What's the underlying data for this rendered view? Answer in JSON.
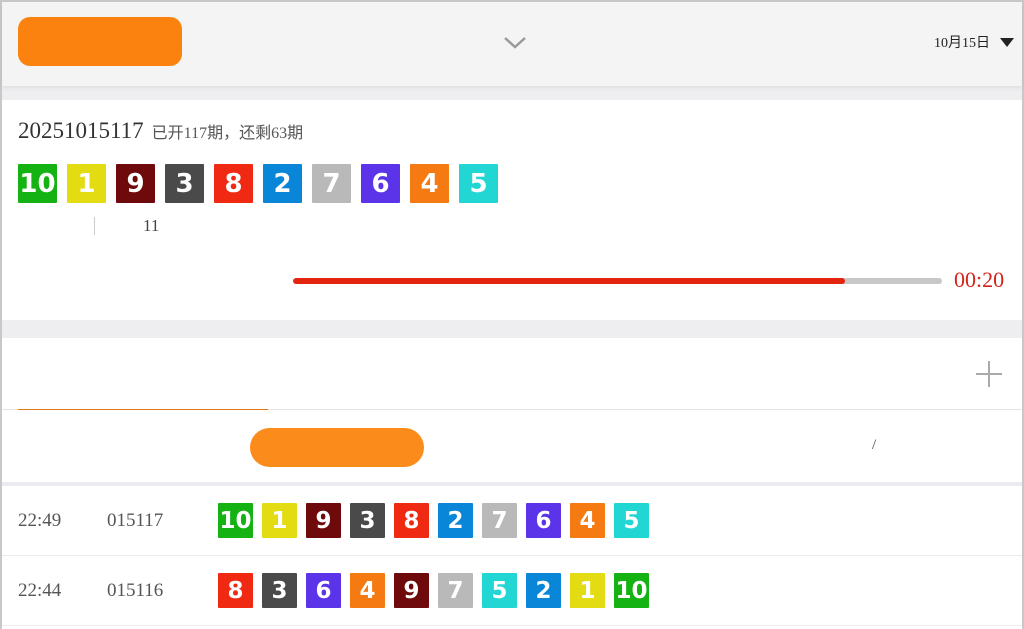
{
  "header": {
    "button_label": "",
    "title": "",
    "date": "10月15日"
  },
  "current": {
    "issue_number": "20251015117",
    "issue_suffix": "",
    "issue_info": "已开117期，还剩63期",
    "balls": [
      10,
      1,
      9,
      3,
      8,
      2,
      7,
      6,
      4,
      5
    ],
    "stats": [
      "",
      "",
      "",
      "",
      ""
    ],
    "stat_label": "",
    "stat_value": "11",
    "stat_extra": [
      "",
      ""
    ],
    "countdown_label": "",
    "countdown_time": "00:20",
    "countdown_progress": 0.85
  },
  "tabs": [
    {
      "label": ""
    },
    {
      "label": ""
    },
    {
      "label": ""
    }
  ],
  "subheader": {
    "col_time": "",
    "col_issue": "",
    "pill": "",
    "col_a": "",
    "col_b": "",
    "col_c": "/"
  },
  "ball_colors": {
    "1": "#e3dc12",
    "2": "#0a86d8",
    "3": "#4a4a4a",
    "4": "#f47a11",
    "5": "#22d6d3",
    "6": "#5b34ea",
    "7": "#b9b9b9",
    "8": "#f02a12",
    "9": "#6e0a0b",
    "10": "#14b313"
  },
  "history": [
    {
      "time": "22:49",
      "issue": "015117",
      "balls": [
        10,
        1,
        9,
        3,
        8,
        2,
        7,
        6,
        4,
        5
      ]
    },
    {
      "time": "22:44",
      "issue": "015116",
      "balls": [
        8,
        3,
        6,
        4,
        9,
        7,
        5,
        2,
        1,
        10
      ]
    }
  ]
}
